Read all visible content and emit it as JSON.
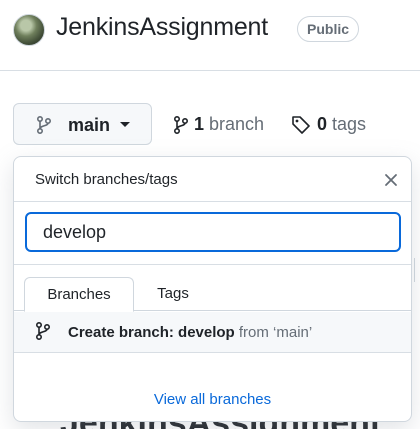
{
  "repo": {
    "name": "JenkinsAssignment",
    "visibility": "Public"
  },
  "branch_selector": {
    "current_branch": "main",
    "icon": "git-branch-icon"
  },
  "stats": {
    "branches_count": "1",
    "branches_label": "branch",
    "tags_count": "0",
    "tags_label": "tags"
  },
  "popover": {
    "title": "Switch branches/tags",
    "filter_value": "develop",
    "tabs": [
      {
        "label": "Branches",
        "selected": true
      },
      {
        "label": "Tags",
        "selected": false
      }
    ],
    "create_prefix": "Create branch: develop",
    "create_from": "from ‘main’",
    "view_all": "View all branches"
  },
  "background": {
    "readme_heading": "JenkinsAssignment"
  },
  "colors": {
    "accent": "#0969da",
    "muted_text": "#656d76",
    "border": "#d0d7de"
  }
}
